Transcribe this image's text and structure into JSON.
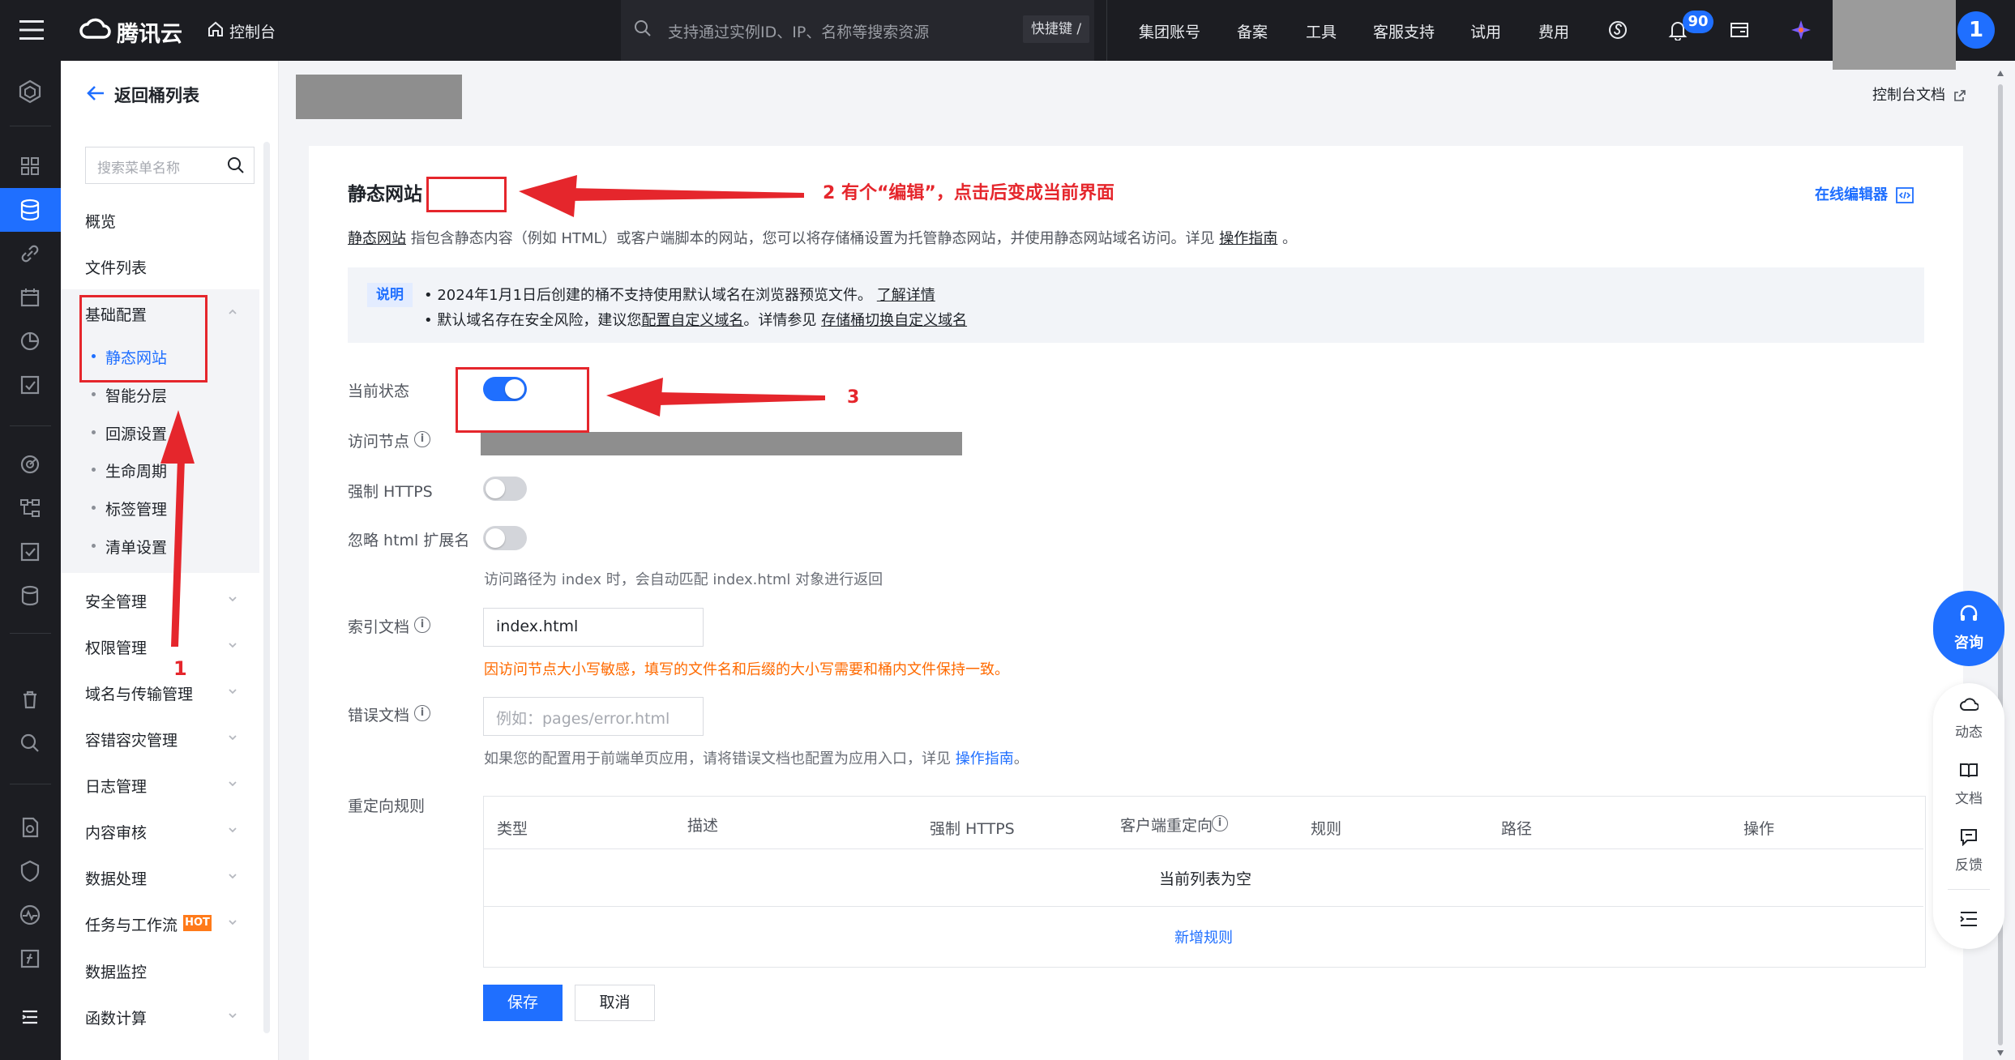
{
  "topbar": {
    "logo_text": "腾讯云",
    "console_label": "控制台",
    "search_placeholder": "支持通过实例ID、IP、名称等搜索资源",
    "shortcut_label": "快捷键 /",
    "nav": [
      "集团账号",
      "备案",
      "工具",
      "客服支持",
      "试用",
      "费用"
    ],
    "notification_count": "90",
    "avatar_initial": "1"
  },
  "menu": {
    "back_label": "返回桶列表",
    "search_placeholder": "搜索菜单名称",
    "items_top": [
      "概览",
      "文件列表"
    ],
    "basic_config": {
      "label": "基础配置",
      "sub": [
        "静态网站",
        "智能分层",
        "回源设置",
        "生命周期",
        "标签管理",
        "清单设置"
      ],
      "active": "静态网站"
    },
    "items_bottom": [
      "安全管理",
      "权限管理",
      "域名与传输管理",
      "容错容灾管理",
      "日志管理",
      "内容审核",
      "数据处理",
      "任务与工作流",
      "数据监控",
      "函数计算"
    ],
    "hot_badge": "HOT"
  },
  "header": {
    "console_doc": "控制台文档"
  },
  "card": {
    "title": "静态网站",
    "online_editor": "在线编辑器",
    "desc_link": "静态网站",
    "desc_text": "指包含静态内容（例如 HTML）或客户端脚本的网站，您可以将存储桶设置为托管静态网站，并使用静态网站域名访问。详见",
    "desc_guide": "操作指南",
    "desc_end": "。",
    "notice": {
      "tag": "说明",
      "line1_text": "2024年1月1日后创建的桶不支持使用默认域名在浏览器预览文件。",
      "line1_link": "了解详情",
      "line2_a": "默认域名存在安全风险，建议您",
      "line2_link1": "配置自定义域名",
      "line2_b": "。详情参见",
      "line2_link2": "存储桶切换自定义域名"
    },
    "form": {
      "status_label": "当前状态",
      "status_on": true,
      "endpoint_label": "访问节点",
      "https_label": "强制 HTTPS",
      "https_on": false,
      "ignore_ext_label": "忽略 html 扩展名",
      "ignore_ext_on": false,
      "ignore_ext_hint": "访问路径为 index 时，会自动匹配 index.html 对象进行返回",
      "index_label": "索引文档",
      "index_value": "index.html",
      "index_warning": "因访问节点大小写敏感，填写的文件名和后缀的大小写需要和桶内文件保持一致。",
      "error_label": "错误文档",
      "error_placeholder": "例如：pages/error.html",
      "error_hint": "如果您的配置用于前端单页应用，请将错误文档也配置为应用入口，详见",
      "error_hint_link": "操作指南",
      "error_hint_end": "。",
      "redirect_label": "重定向规则"
    },
    "table": {
      "columns": [
        "类型",
        "描述",
        "强制 HTTPS",
        "客户端重定向",
        "规则",
        "路径",
        "操作"
      ],
      "empty": "当前列表为空",
      "add_rule": "新增规则"
    },
    "save": "保存",
    "cancel": "取消"
  },
  "side_tools": {
    "consult": "咨询",
    "items": [
      "动态",
      "文档",
      "反馈"
    ]
  },
  "annotations": {
    "a1": "1",
    "a2": "2 有个“编辑”，点击后变成当前界面",
    "a3": "3",
    "color": "#e5262c"
  }
}
